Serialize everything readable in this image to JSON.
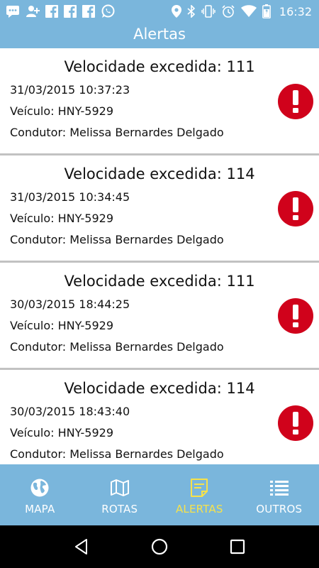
{
  "status_bar": {
    "time": "16:32",
    "left_icons": [
      "messages-icon",
      "add-contact-icon",
      "facebook-icon",
      "facebook-icon",
      "facebook-icon",
      "whatsapp-icon"
    ],
    "right_icons": [
      "location-icon",
      "bluetooth-icon",
      "vibrate-icon",
      "alarm-icon",
      "wifi-icon",
      "battery-icon"
    ]
  },
  "header": {
    "title": "Alertas"
  },
  "alerts": [
    {
      "title": "Velocidade excedida: 111",
      "datetime": "31/03/2015 10:37:23",
      "vehicle": "Veículo: HNY-5929",
      "driver": "Condutor: Melissa Bernardes Delgado"
    },
    {
      "title": "Velocidade excedida: 114",
      "datetime": "31/03/2015 10:34:45",
      "vehicle": "Veículo: HNY-5929",
      "driver": "Condutor: Melissa Bernardes Delgado"
    },
    {
      "title": "Velocidade excedida: 111",
      "datetime": "30/03/2015 18:44:25",
      "vehicle": "Veículo: HNY-5929",
      "driver": "Condutor: Melissa Bernardes Delgado"
    },
    {
      "title": "Velocidade excedida: 114",
      "datetime": "30/03/2015 18:43:40",
      "vehicle": "Veículo: HNY-5929",
      "driver": "Condutor: Melissa Bernardes Delgado"
    }
  ],
  "bottom_nav": {
    "items": [
      {
        "label": "MAPA",
        "icon": "globe-icon",
        "active": false
      },
      {
        "label": "ROTAS",
        "icon": "map-icon",
        "active": false
      },
      {
        "label": "ALERTAS",
        "icon": "note-icon",
        "active": true
      },
      {
        "label": "OUTROS",
        "icon": "list-icon",
        "active": false
      }
    ]
  },
  "colors": {
    "primary": "#7ab6dc",
    "active_tab": "#f7e24a",
    "alert_red": "#d0021b",
    "divider": "#c2c2c2"
  }
}
